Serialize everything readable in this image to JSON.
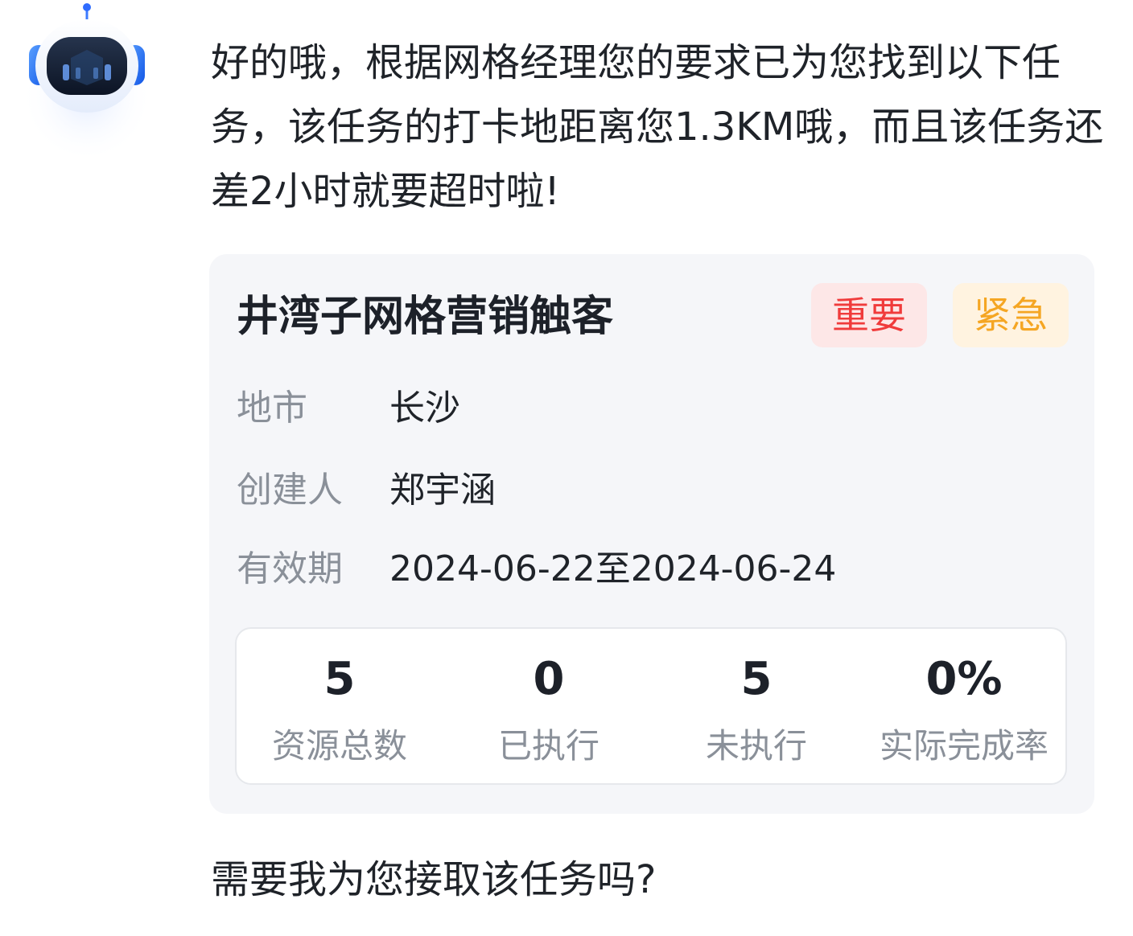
{
  "assistant": {
    "avatar_icon": "robot-icon",
    "message": "好的哦，根据网格经理您的要求已为您找到以下任务，该任务的打卡地距离您1.3KM哦，而且该任务还差2小时就要超时啦!"
  },
  "task_card": {
    "title": "井湾子网格营销触客",
    "tags": {
      "important": "重要",
      "urgent": "紧急"
    },
    "info": {
      "city_label": "地市",
      "city_value": "长沙",
      "creator_label": "创建人",
      "creator_value": "郑宇涵",
      "validity_label": "有效期",
      "validity_value": "2024-06-22至2024-06-24"
    },
    "stats": [
      {
        "value": "5",
        "label": "资源总数"
      },
      {
        "value": "0",
        "label": "已执行"
      },
      {
        "value": "5",
        "label": "未执行"
      },
      {
        "value": "0%",
        "label": "实际完成率"
      }
    ]
  },
  "followup": {
    "question": "需要我为您接取该任务吗?"
  },
  "colors": {
    "important_text": "#f03b3b",
    "important_bg": "#fde7e7",
    "urgent_text": "#f5a623",
    "urgent_bg": "#fff3e0",
    "card_bg": "#f5f6f9",
    "label_gray": "#8a9099",
    "avatar_blue": "#1e6fff"
  }
}
